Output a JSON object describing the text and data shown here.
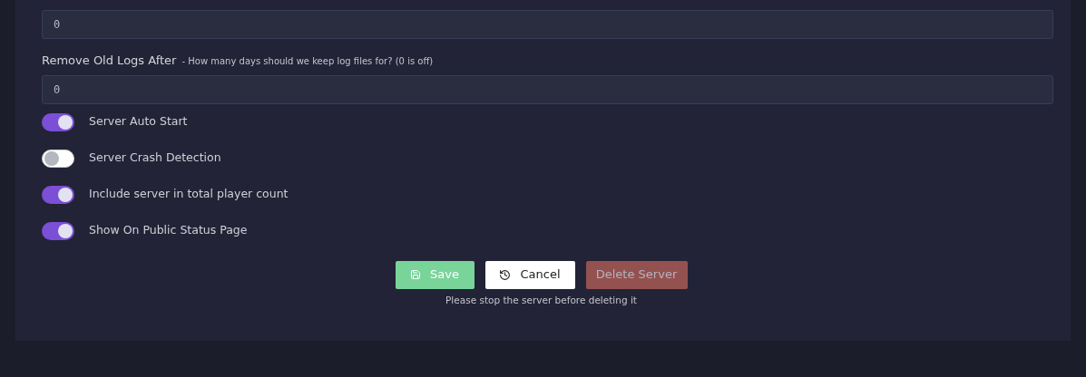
{
  "fields": [
    {
      "value": "0"
    },
    {
      "label": "Remove Old Logs After",
      "hint": "- How many days should we keep log files for? (0 is off)",
      "value": "0"
    }
  ],
  "toggles": [
    {
      "label": "Server Auto Start",
      "on": true
    },
    {
      "label": "Server Crash Detection",
      "on": false
    },
    {
      "label": "Include server in total player count",
      "on": true
    },
    {
      "label": "Show On Public Status Page",
      "on": true
    }
  ],
  "buttons": [
    {
      "kind": "save",
      "label": "Save",
      "disabled": false
    },
    {
      "kind": "cancel",
      "label": "Cancel",
      "disabled": false
    },
    {
      "kind": "delete",
      "label": "Delete Server",
      "disabled": true
    }
  ],
  "note": "Please stop the server before deleting it"
}
